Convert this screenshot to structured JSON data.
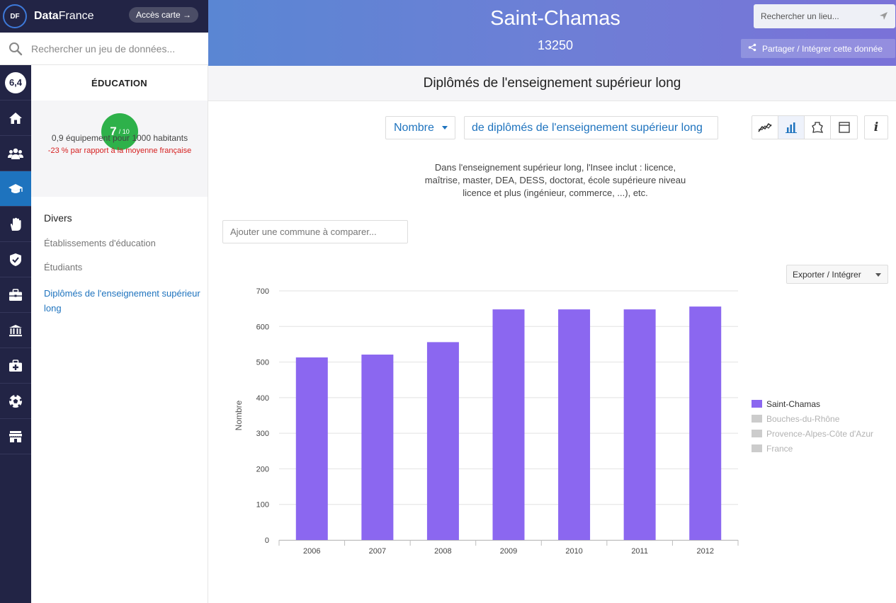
{
  "brand": {
    "logo": "DF",
    "name_bold": "Data",
    "name_rest": "France",
    "map_button": "Accès carte →"
  },
  "dataset_search": {
    "placeholder": "Rechercher un jeu de données..."
  },
  "header": {
    "city": "Saint-Chamas",
    "postal_code": "13250",
    "place_search_placeholder": "Rechercher un lieu...",
    "share_label": "Partager / Intégrer cette donnée"
  },
  "rail": {
    "score": "6,4",
    "items": [
      "home-icon",
      "population-icon",
      "education-icon",
      "hand-icon",
      "security-icon",
      "employment-icon",
      "institutions-icon",
      "health-icon",
      "sports-icon",
      "shops-icon"
    ]
  },
  "category": {
    "title": "ÉDUCATION",
    "score": "7",
    "score_max": "/ 10",
    "equipment": "0,9 équipement pour 1000 habitants",
    "comparison": "-23 % par rapport à la moyenne française",
    "group": "Divers",
    "items": [
      "Établissements d'éducation",
      "Étudiants",
      "Diplômés de l'enseignement supérieur long"
    ]
  },
  "main": {
    "title": "Diplômés de l'enseignement supérieur long",
    "measure_select": "Nombre",
    "indicator_select": "de diplômés de l'enseignement supérieur long",
    "description": "Dans l'enseignement supérieur long, l'Insee inclut : licence, maîtrise, master, DEA, DESS, doctorat, école supérieure niveau licence et plus (ingénieur, commerce, ...), etc.",
    "compare_placeholder": "Ajouter une commune à comparer...",
    "export_label": "Exporter / Intégrer",
    "view_buttons": [
      "line-chart-icon",
      "bar-chart-icon",
      "map-icon",
      "table-icon"
    ],
    "info_label": "i"
  },
  "colors": {
    "accent": "#1e73be",
    "bar": "#8b67f0",
    "score_green": "#2eb14a",
    "negative": "#d61f1f",
    "inactive_legend": "#cccccc"
  },
  "chart_data": {
    "type": "bar",
    "categories": [
      "2006",
      "2007",
      "2008",
      "2009",
      "2010",
      "2011",
      "2012"
    ],
    "series": [
      {
        "name": "Saint-Chamas",
        "values": [
          513,
          521,
          556,
          648,
          648,
          648,
          656
        ],
        "color": "#8b67f0",
        "active": true
      },
      {
        "name": "Bouches-du-Rhône",
        "active": false
      },
      {
        "name": "Provence-Alpes-Côte d'Azur",
        "active": false
      },
      {
        "name": "France",
        "active": false
      }
    ],
    "ylabel": "Nombre",
    "ylim": [
      0,
      700
    ],
    "yticks": [
      0,
      100,
      200,
      300,
      400,
      500,
      600,
      700
    ],
    "grid": true,
    "legend": "right"
  }
}
